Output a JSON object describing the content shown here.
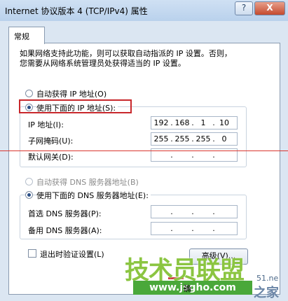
{
  "window": {
    "title": "Internet 协议版本 4 (TCP/IPv4) 属性",
    "help_label": "?",
    "close_label": "X"
  },
  "tab": {
    "label": "常规"
  },
  "description": {
    "line1": "如果网络支持此功能，则可以获取自动指派的 IP 设置。否则，",
    "line2": "您需要从网络系统管理员处获得适当的 IP 设置。"
  },
  "ip": {
    "auto_label": "自动获得 IP 地址(O)",
    "manual_label": "使用下面的 IP 地址(S):",
    "selected": "manual",
    "fields": [
      {
        "label": "IP 地址(I):",
        "octets": [
          "192",
          "168",
          "1",
          "10"
        ]
      },
      {
        "label": "子网掩码(U):",
        "octets": [
          "255",
          "255",
          "255",
          "0"
        ]
      },
      {
        "label": "默认网关(D):",
        "octets": [
          "",
          "",
          "",
          ""
        ]
      }
    ]
  },
  "dns": {
    "auto_label": "自动获得 DNS 服务器地址(B)",
    "manual_label": "使用下面的 DNS 服务器地址(E):",
    "selected": "manual",
    "fields": [
      {
        "label": "首选 DNS 服务器(P):",
        "octets": [
          "",
          "",
          "",
          ""
        ]
      },
      {
        "label": "备用 DNS 服务器(A):",
        "octets": [
          "",
          "",
          "",
          ""
        ]
      }
    ]
  },
  "validate": {
    "label": "退出时验证设置(L)",
    "checked": false
  },
  "advanced_button": {
    "label": "高级(V)..."
  },
  "watermark": {
    "brand": "技术员联盟",
    "url": "www.jsgho.com",
    "site_frag": "51.ne",
    "site_cn": "之家",
    "frag": "确"
  },
  "colors": {
    "highlight_box": "#c8282c",
    "watermark_green": "#8bc541"
  }
}
